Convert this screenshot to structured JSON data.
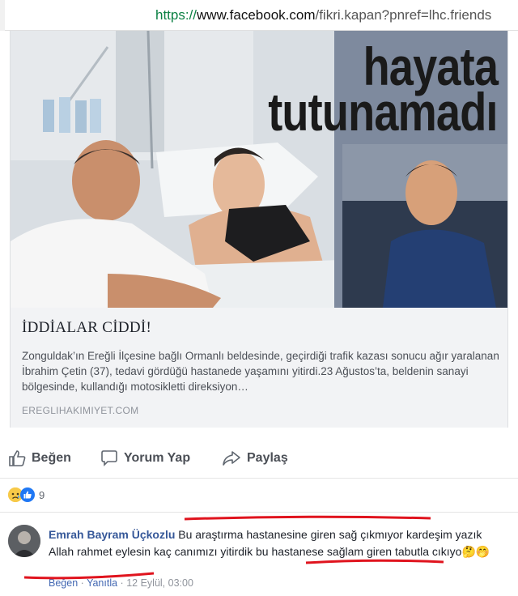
{
  "browser": {
    "url_scheme": "https://",
    "url_host": "www.facebook.com",
    "url_path": "/fikri.kapan?pnref=lhc.friends"
  },
  "card": {
    "image_text_line1": "hayata",
    "image_text_line2": "tutunamadı",
    "title": "İDDİALAR CİDDİ!",
    "description": "Zonguldak’ın Ereğli İlçesine bağlı Ormanlı beldesinde, geçirdiği trafik kazası sonucu ağır yaralanan İbrahim Çetin (37), tedavi gördüğü hastanede yaşamını yitirdi.23 Ağustos’ta, beldenin sanayi bölgesinde, kullandığı motosikletti direksiyon…",
    "domain": "EREGLIHAKIMIYET.COM"
  },
  "actions": {
    "like": "Beğen",
    "comment": "Yorum Yap",
    "share": "Paylaş"
  },
  "reactions": {
    "icons": [
      "sad-emoji-icon",
      "like-reaction-icon"
    ],
    "count": "9"
  },
  "comment": {
    "author": "Emrah Bayram Üçkozlu",
    "text": "Bu araştırma hastanesine giren sağ çıkmıyor kardeşim yazık Allah rahmet eylesin kaç canımızı yitirdik bu hastanese sağlam giren tabutla cıkıyo",
    "emoji": "🤔🤭",
    "like": "Beğen",
    "reply": "Yanıtla",
    "separator": "·",
    "timestamp": "12 Eylül, 03:00"
  },
  "colors": {
    "link_blue": "#365899",
    "secure_green": "#0b8043",
    "annotation_red": "#e0141e",
    "card_footer_bg": "#f2f3f5"
  }
}
